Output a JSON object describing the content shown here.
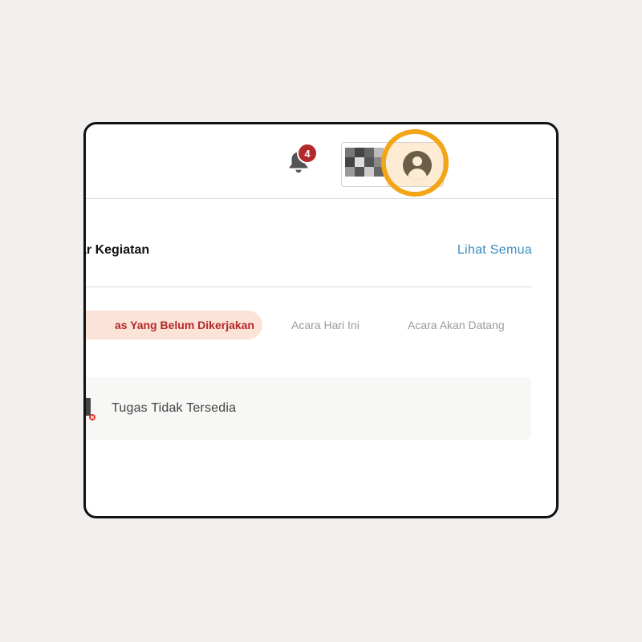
{
  "header": {
    "notification_count": "4",
    "bell_icon": "bell-icon",
    "avatar_icon": "user-avatar-icon"
  },
  "section": {
    "title": "ar Kegiatan",
    "see_all_label": "Lihat Semua"
  },
  "tabs": [
    {
      "label": "as Yang Belum Dikerjakan",
      "active": true
    },
    {
      "label": "Acara Hari Ini",
      "active": false
    },
    {
      "label": "Acara Akan Datang",
      "active": false
    }
  ],
  "empty_state": {
    "message": "Tugas Tidak Tersedia",
    "icon": "task-unavailable-icon"
  },
  "colors": {
    "accent_red": "#b3282b",
    "link_blue": "#3a8bbf",
    "highlight_orange": "#f2a516",
    "active_tab_bg": "#fbe3d7"
  }
}
